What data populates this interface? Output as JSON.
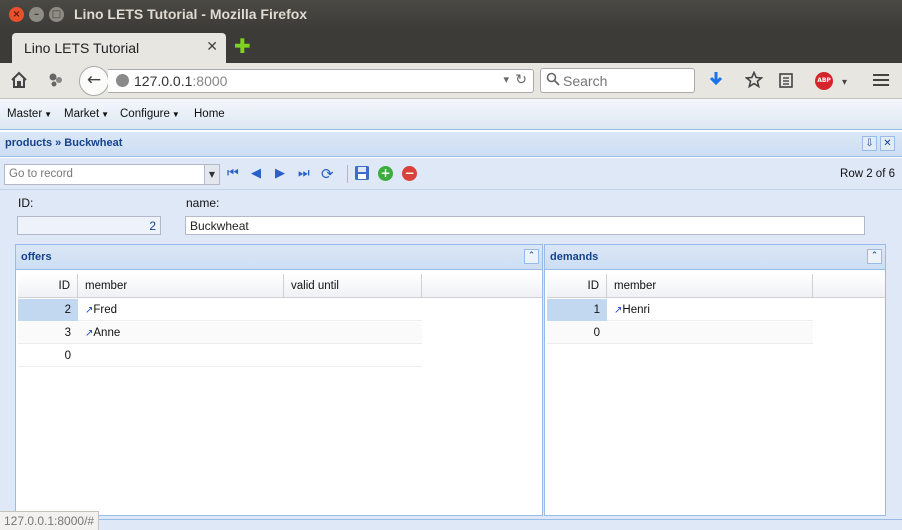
{
  "window": {
    "title": "Lino LETS Tutorial - Mozilla Firefox",
    "close_glyph": "×",
    "min_glyph": "–",
    "max_glyph": "□"
  },
  "tab": {
    "title": "Lino LETS Tutorial",
    "close_glyph": "✕",
    "new_tab_glyph": "✚"
  },
  "navbar": {
    "url_host": "127.0.0.1",
    "url_port": ":8000",
    "search_placeholder": "Search",
    "home_icon": "home-icon",
    "back_glyph": "←",
    "drop_glyph": "▾",
    "reload_glyph": "↻",
    "search_glyph": "🔍",
    "abp_label": "ABP"
  },
  "menu": {
    "items": [
      "Master",
      "Market",
      "Configure",
      "Home"
    ]
  },
  "panel": {
    "breadcrumb": "products » Buckwheat",
    "pin_glyph": "⇩",
    "close_glyph": "✕"
  },
  "toolbar": {
    "goto_placeholder": "Go to record",
    "row_info": "Row 2 of 6",
    "combo_glyph": "▼",
    "first_glyph": "⏮",
    "prev_glyph": "◀",
    "next_glyph": "▶",
    "last_glyph": "⏭",
    "refresh_glyph": "⟳",
    "save_glyph": "💾",
    "add_glyph": "+",
    "delete_glyph": "−"
  },
  "form": {
    "id_label": "ID:",
    "id_value": "2",
    "name_label": "name:",
    "name_value": "Buckwheat"
  },
  "offers": {
    "title": "offers",
    "collapse_glyph": "⌃",
    "columns": [
      "ID",
      "member",
      "valid until"
    ],
    "rows": [
      {
        "id": "2",
        "member": "Fred",
        "valid_until": ""
      },
      {
        "id": "3",
        "member": "Anne",
        "valid_until": ""
      },
      {
        "id": "0",
        "member": "",
        "valid_until": ""
      }
    ]
  },
  "demands": {
    "title": "demands",
    "collapse_glyph": "⌃",
    "columns": [
      "ID",
      "member"
    ],
    "rows": [
      {
        "id": "1",
        "member": "Henri"
      },
      {
        "id": "0",
        "member": ""
      }
    ]
  },
  "link_arrow": "↗",
  "status": {
    "text": "127.0.0.1:8000/#"
  },
  "colors": {
    "accent": "#15428b",
    "panel_bg": "#dfe8f6",
    "selected_cell": "#c2d7f0"
  }
}
